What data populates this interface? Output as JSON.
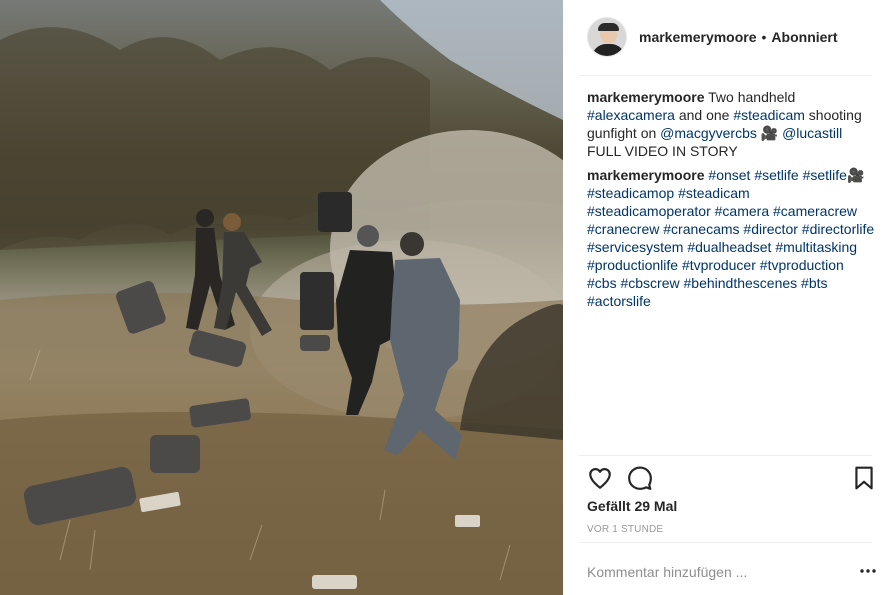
{
  "post": {
    "username": "markemerymoore",
    "separator": "•",
    "follow_status": "Abonniert",
    "likes_text": "Gefällt 29 Mal",
    "timestamp": "VOR 1 STUNDE",
    "add_comment_placeholder": "Kommentar hinzufügen ..."
  },
  "caption": {
    "username": "markemerymoore",
    "segments": [
      {
        "type": "text",
        "value": " Two handheld "
      },
      {
        "type": "tag",
        "value": "#alexacamera"
      },
      {
        "type": "text",
        "value": " and one "
      },
      {
        "type": "tag",
        "value": "#steadicam"
      },
      {
        "type": "text",
        "value": " shooting gunfight on "
      },
      {
        "type": "tag",
        "value": "@macgyvercbs"
      },
      {
        "type": "text",
        "value": " 🎥 "
      },
      {
        "type": "tag",
        "value": "@lucastill"
      },
      {
        "type": "text",
        "value": " FULL VIDEO IN STORY"
      }
    ]
  },
  "tags_comment": {
    "username": "markemerymoore",
    "segments": [
      {
        "type": "tag",
        "value": "#onset"
      },
      {
        "type": "text",
        "value": " "
      },
      {
        "type": "tag",
        "value": "#setlife"
      },
      {
        "type": "text",
        "value": " "
      },
      {
        "type": "tag",
        "value": "#setlife🎥"
      },
      {
        "type": "text",
        "value": " "
      },
      {
        "type": "tag",
        "value": "#steadicamop"
      },
      {
        "type": "text",
        "value": " "
      },
      {
        "type": "tag",
        "value": "#steadicam"
      },
      {
        "type": "text",
        "value": " "
      },
      {
        "type": "tag",
        "value": "#steadicamoperator"
      },
      {
        "type": "text",
        "value": " "
      },
      {
        "type": "tag",
        "value": "#camera"
      },
      {
        "type": "text",
        "value": " "
      },
      {
        "type": "tag",
        "value": "#cameracrew"
      },
      {
        "type": "text",
        "value": " "
      },
      {
        "type": "tag",
        "value": "#cranecrew"
      },
      {
        "type": "text",
        "value": " "
      },
      {
        "type": "tag",
        "value": "#cranecams"
      },
      {
        "type": "text",
        "value": " "
      },
      {
        "type": "tag",
        "value": "#director"
      },
      {
        "type": "text",
        "value": " "
      },
      {
        "type": "tag",
        "value": "#directorlife"
      },
      {
        "type": "text",
        "value": " "
      },
      {
        "type": "tag",
        "value": "#servicesystem"
      },
      {
        "type": "text",
        "value": " "
      },
      {
        "type": "tag",
        "value": "#dualheadset"
      },
      {
        "type": "text",
        "value": " "
      },
      {
        "type": "tag",
        "value": "#multitasking"
      },
      {
        "type": "text",
        "value": " "
      },
      {
        "type": "tag",
        "value": "#productionlife"
      },
      {
        "type": "text",
        "value": " "
      },
      {
        "type": "tag",
        "value": "#tvproducer"
      },
      {
        "type": "text",
        "value": " "
      },
      {
        "type": "tag",
        "value": "#tvproduction"
      },
      {
        "type": "text",
        "value": " "
      },
      {
        "type": "tag",
        "value": "#cbs"
      },
      {
        "type": "text",
        "value": " "
      },
      {
        "type": "tag",
        "value": "#cbscrew"
      },
      {
        "type": "text",
        "value": " "
      },
      {
        "type": "tag",
        "value": "#behindthescenes"
      },
      {
        "type": "text",
        "value": " "
      },
      {
        "type": "tag",
        "value": "#bts"
      },
      {
        "type": "text",
        "value": " "
      },
      {
        "type": "tag",
        "value": "#actorslife"
      }
    ]
  },
  "icons": {
    "like": "heart-icon",
    "comment": "speech-bubble-icon",
    "save": "bookmark-icon",
    "more": "more-dots-icon"
  },
  "colors": {
    "hashtag": "#003569",
    "text": "#262626",
    "muted": "#999999",
    "divider": "#efefef"
  }
}
